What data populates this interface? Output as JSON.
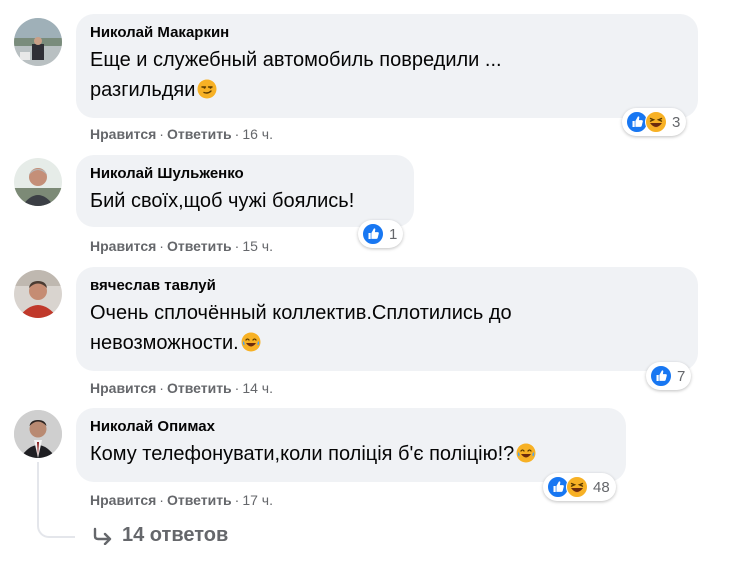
{
  "comments": [
    {
      "author": "Николай Макаркин",
      "text": [
        "Еще и служебный автомобиль повредили ...",
        "разгильдяи"
      ],
      "like_label": "Нравится",
      "reply_label": "Ответить",
      "time": "16 ч.",
      "reactions": [
        "like",
        "haha"
      ],
      "reaction_count": "3"
    },
    {
      "author": "Николай Шульженко",
      "text": [
        "Бий своїх,щоб чужі боялись!"
      ],
      "like_label": "Нравится",
      "reply_label": "Ответить",
      "time": "15 ч.",
      "reactions": [
        "like"
      ],
      "reaction_count": "1"
    },
    {
      "author": "вячеслав тавлуй",
      "text": [
        "Очень сплочённый коллектив.Сплотились до",
        "невозможности."
      ],
      "like_label": "Нравится",
      "reply_label": "Ответить",
      "time": "14 ч.",
      "reactions": [
        "like"
      ],
      "reaction_count": "7"
    },
    {
      "author": "Николай Опимах",
      "text": [
        "Кому телефонувати,коли поліція б'є поліцію!?"
      ],
      "like_label": "Нравится",
      "reply_label": "Ответить",
      "time": "17 ч.",
      "reactions": [
        "like",
        "haha"
      ],
      "reaction_count": "48"
    }
  ],
  "replies_link": "14 ответов",
  "separator": "·",
  "colors": {
    "like_blue": "#1877f2",
    "bubble": "#f0f2f5",
    "meta_gray": "#65676b",
    "emoji_yellow": "#f7b125"
  }
}
